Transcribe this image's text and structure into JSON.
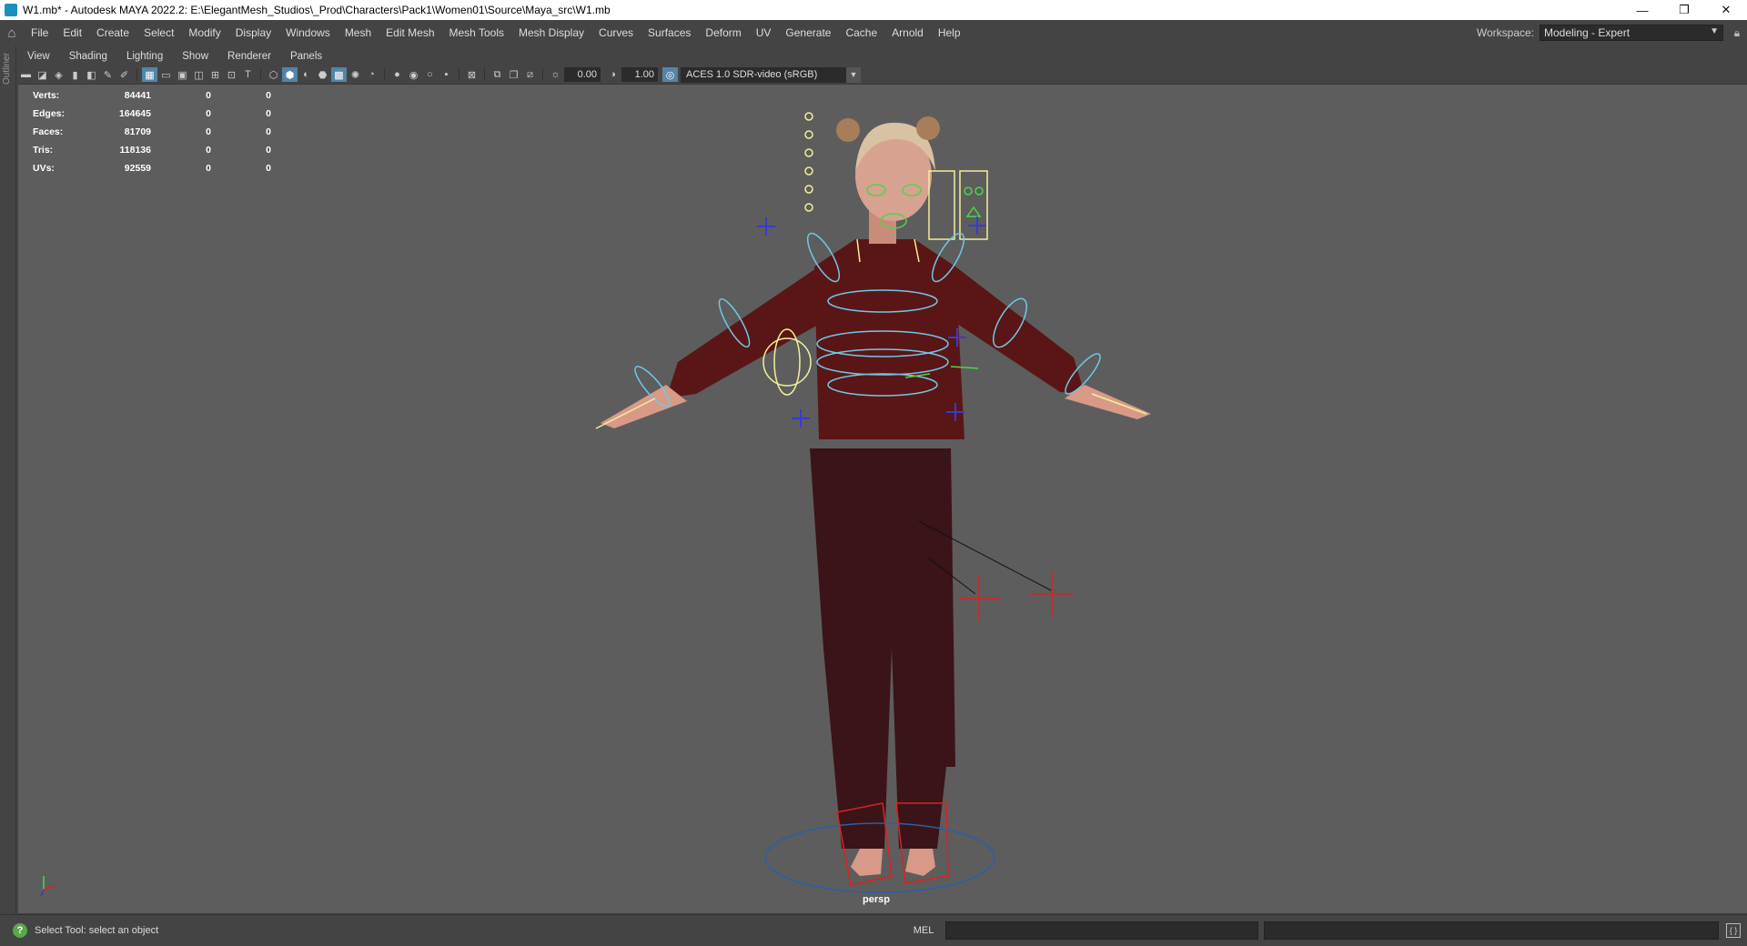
{
  "window": {
    "title": "W1.mb* - Autodesk MAYA 2022.2: E:\\ElegantMesh_Studios\\_Prod\\Characters\\Pack1\\Women01\\Source\\Maya_src\\W1.mb",
    "minimize": "—",
    "restore": "❐",
    "close": "✕"
  },
  "menubar": {
    "items": [
      "File",
      "Edit",
      "Create",
      "Select",
      "Modify",
      "Display",
      "Windows",
      "Mesh",
      "Edit Mesh",
      "Mesh Tools",
      "Mesh Display",
      "Curves",
      "Surfaces",
      "Deform",
      "UV",
      "Generate",
      "Cache",
      "Arnold",
      "Help"
    ],
    "workspace_label": "Workspace:",
    "workspace_value": "Modeling - Expert"
  },
  "outliner_tab": "Outliner",
  "panel_menu": [
    "View",
    "Shading",
    "Lighting",
    "Show",
    "Renderer",
    "Panels"
  ],
  "toolbar": {
    "exposure": "0.00",
    "gamma": "1.00",
    "colorspace": "ACES 1.0 SDR-video (sRGB)"
  },
  "hud": [
    {
      "label": "Verts:",
      "value": "84441",
      "a": "0",
      "b": "0"
    },
    {
      "label": "Edges:",
      "value": "164645",
      "a": "0",
      "b": "0"
    },
    {
      "label": "Faces:",
      "value": "81709",
      "a": "0",
      "b": "0"
    },
    {
      "label": "Tris:",
      "value": "118136",
      "a": "0",
      "b": "0"
    },
    {
      "label": "UVs:",
      "value": "92559",
      "a": "0",
      "b": "0"
    }
  ],
  "camera_label": "persp",
  "status": {
    "help_text": "Select Tool: select an object",
    "command_type": "MEL"
  },
  "colors": {
    "viewport_bg": "#5d5d5d",
    "ui_bg": "#444444",
    "highlight": "#5285a6",
    "control_cyan": "#6fc8e8",
    "control_yellow": "#f3ef9a",
    "control_green": "#4cd64c",
    "control_red": "#e02020",
    "control_blue": "#3a3ad0",
    "sweater": "#5a1616",
    "pants": "#3a1418"
  }
}
